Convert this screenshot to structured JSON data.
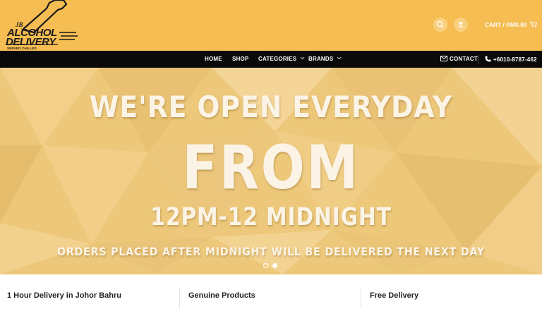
{
  "header": {
    "logo": {
      "jb": "JB",
      "line1": "ALCOHOL",
      "line2": "DELIVERY",
      "tagline": "SERVED CHILLED"
    },
    "search_icon": "⌕",
    "account_icon": "▲",
    "cart_label": "CART / RM0.00",
    "cart_icon": "Ὥ2"
  },
  "nav": {
    "items": [
      {
        "label": "HOME"
      },
      {
        "label": "SHOP"
      },
      {
        "label": "CATEGORIES"
      },
      {
        "label": "BRANDS"
      }
    ],
    "contact_label": "CONTACT",
    "phone_label": "+6010-8787-462"
  },
  "hero": {
    "line1": "WE'RE OPEN EVERYDAY",
    "line2": "FROM",
    "line3": "12PM-12 MIDNIGHT",
    "line4": "ORDERS PLACED AFTER MIDNIGHT WILL BE DELIVERED THE NEXT DAY",
    "active_slide": 2,
    "slide_count": 2
  },
  "features": [
    {
      "title": "1 Hour Delivery in Johor Bahru"
    },
    {
      "title": "Genuine Products"
    },
    {
      "title": "Free Delivery"
    }
  ],
  "colors": {
    "header_bg": "#f5bd52",
    "nav_bg": "#0a0a0a",
    "hero_bg": "#edc87a",
    "hero_text": "#fbf4e6"
  }
}
